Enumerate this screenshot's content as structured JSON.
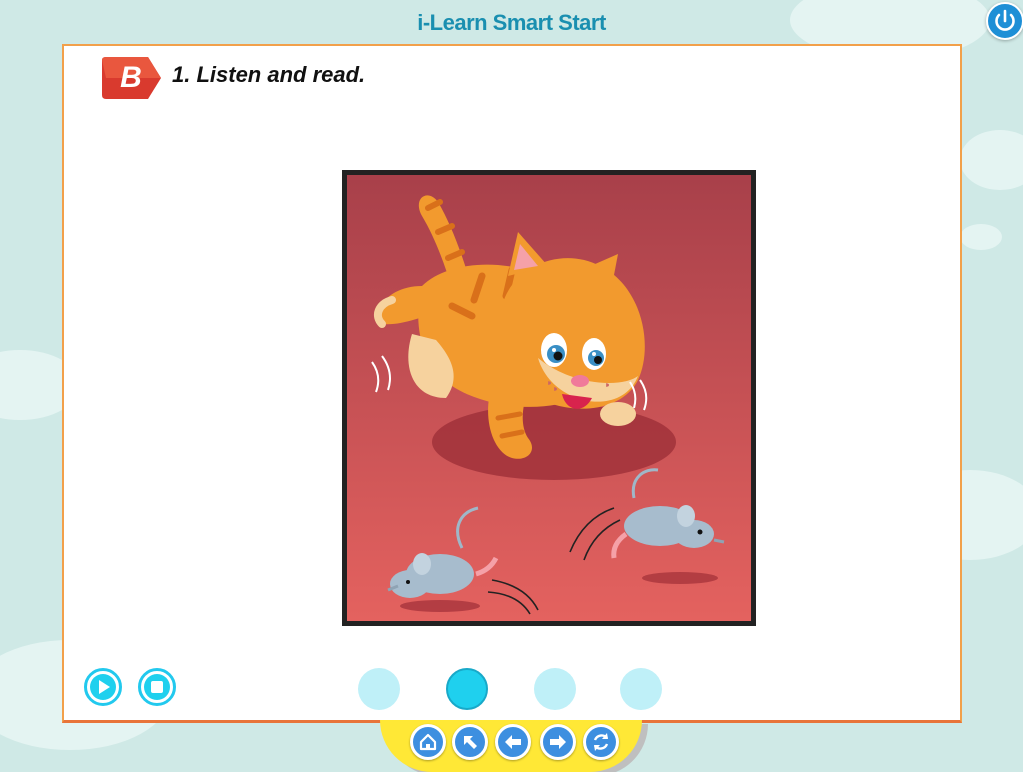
{
  "app": {
    "title": "i-Learn Smart Start"
  },
  "exercise": {
    "section_letter": "B",
    "instruction": "1. Listen and read."
  },
  "illustration": {
    "name": "cat-chasing-mice-illustration"
  },
  "audio_controls": {
    "play": "play-icon",
    "stop": "stop-icon"
  },
  "pagination": {
    "pages": 4,
    "current_page": 2
  },
  "bottom_nav": [
    "home-icon",
    "arrow-up-left-icon",
    "arrow-left-icon",
    "arrow-right-icon",
    "refresh-icon"
  ],
  "colors": {
    "panel_border": "#f2a04a",
    "accent": "#1fd0ee",
    "nav": "#3d8fe0",
    "bar": "#ffe836"
  }
}
